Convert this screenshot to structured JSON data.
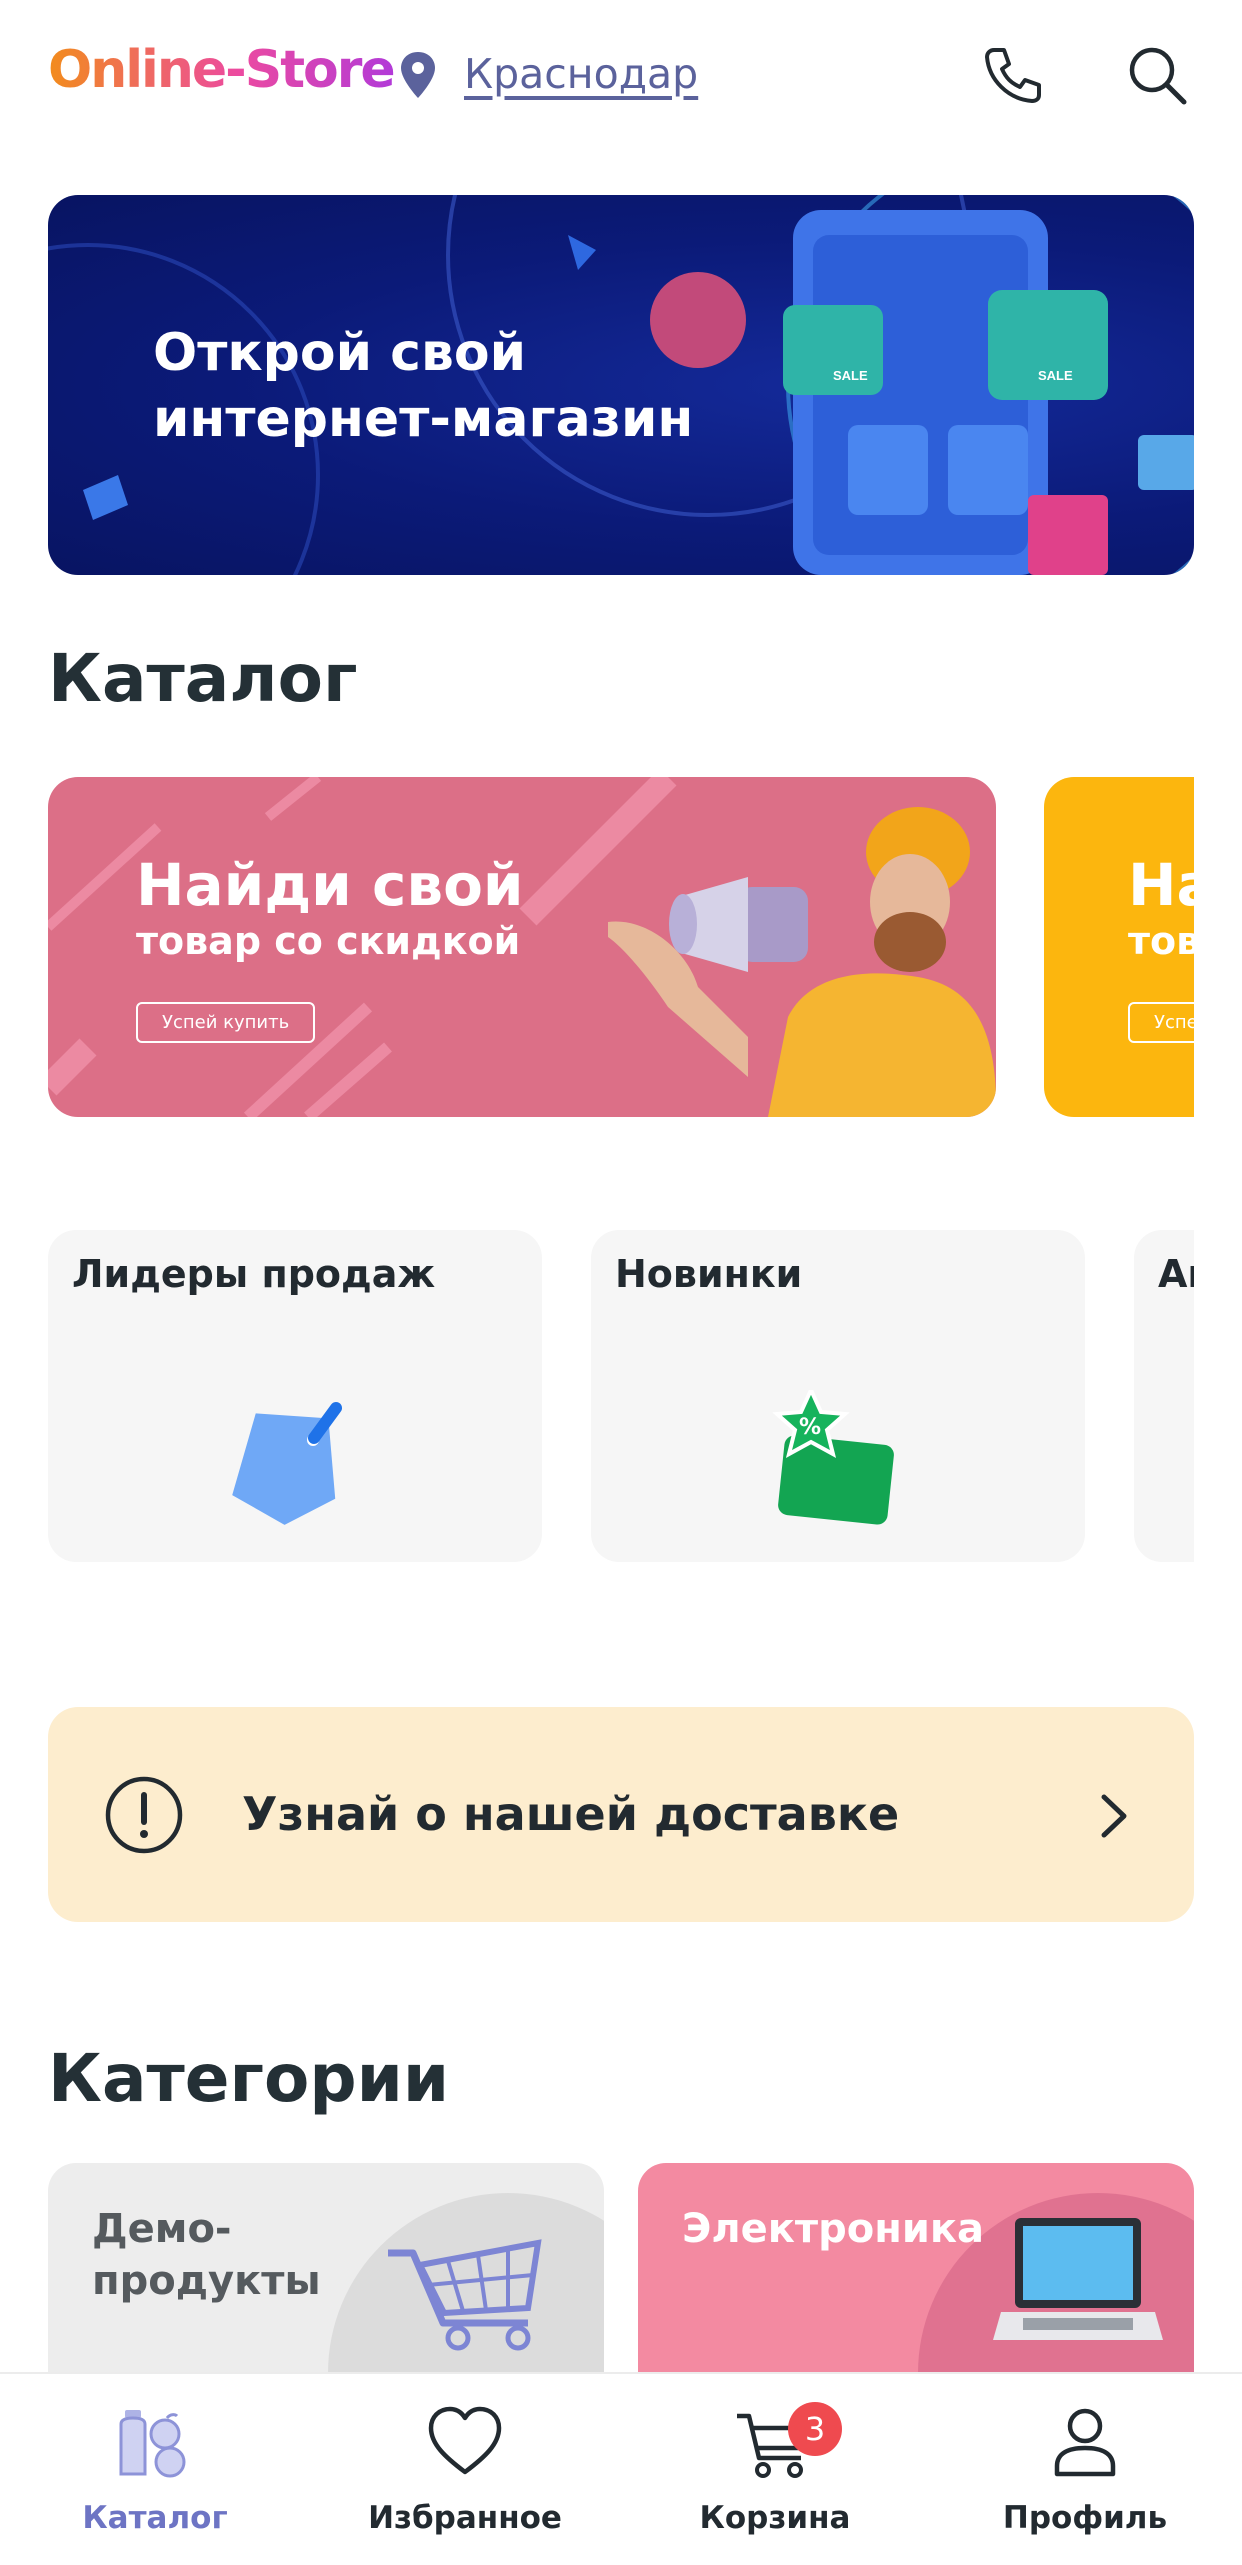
{
  "header": {
    "logo_text": "Online-Store",
    "city": "Краснодар",
    "icons": [
      "location-pin-icon",
      "phone-icon",
      "search-icon"
    ]
  },
  "promo_banner": {
    "title": "Открой свой\nинтернет-магазин",
    "badges": [
      "SALE",
      "SALE"
    ]
  },
  "catalog": {
    "title": "Каталог",
    "banners": [
      {
        "title": "Найди свой",
        "subtitle": "товар со скидкой",
        "button": "Успей купить",
        "color": "#dc6f87"
      },
      {
        "title": "На",
        "subtitle": "тов",
        "button": "Успе",
        "color": "#fcb60e"
      }
    ],
    "collections": [
      {
        "label": "Лидеры продаж",
        "icon": "price-tag-icon"
      },
      {
        "label": "Новинки",
        "icon": "discount-star-icon"
      },
      {
        "label": "Ак"
      }
    ]
  },
  "delivery": {
    "text": "Узнай о нашей доставке",
    "icon": "info-exclamation-icon"
  },
  "categories": {
    "title": "Категории",
    "items": [
      {
        "label": "Демо-\nпродукты",
        "icon": "shopping-cart-icon",
        "color": "#ededed"
      },
      {
        "label": "Электроника",
        "icon": "laptop-icon",
        "color": "#f38aa1"
      }
    ]
  },
  "bottom_nav": {
    "items": [
      {
        "label": "Каталог",
        "icon": "catalog-icon",
        "active": true
      },
      {
        "label": "Избранное",
        "icon": "heart-icon"
      },
      {
        "label": "Корзина",
        "icon": "cart-icon",
        "badge": "3"
      },
      {
        "label": "Профиль",
        "icon": "user-icon"
      }
    ]
  },
  "colors": {
    "accent": "#6d74c4",
    "city_link": "#5b629c",
    "promo_bg": "#0b1a78",
    "delivery_bg": "#fdedce",
    "badge": "#ef4a4f"
  }
}
